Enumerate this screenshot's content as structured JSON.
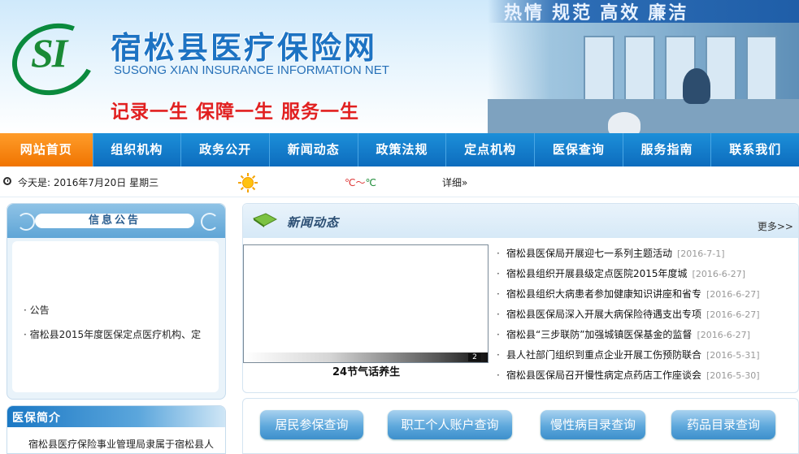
{
  "header": {
    "title": "宿松县医疗保险网",
    "subtitle": "SUSONG XIAN INSURANCE INFORMATION NET",
    "motto": "记录一生  保障一生  服务一生",
    "logo_text": "SI",
    "banner_slogan": "热情  规范  高效  廉洁",
    "colors": {
      "title": "#1d73c3",
      "motto": "#e12020",
      "logo": "#1a8a35"
    }
  },
  "nav": {
    "items": [
      "网站首页",
      "组织机构",
      "政务公开",
      "新闻动态",
      "政策法规",
      "定点机构",
      "医保查询",
      "服务指南",
      "联系我们"
    ],
    "active": "网站首页",
    "colors": {
      "bar": "#0d6cbd",
      "active": "#f07400"
    }
  },
  "datebar": {
    "date": "今天是: 2016年7月20日  星期三",
    "weather_icon": "sun-icon",
    "temp_a": "℃～",
    "temp_b": "℃",
    "detail": "详细»"
  },
  "notice": {
    "title": "信息公告",
    "items": [
      "· 公告",
      "· 宿松县2015年度医保定点医疗机构、定"
    ]
  },
  "intro": {
    "title": "医保简介",
    "text": "宿松县医疗保险事业管理局隶属于宿松县人"
  },
  "news": {
    "title": "新闻动态",
    "more": "更多>>",
    "slide_caption": "24节气话养生",
    "slide_number": "2",
    "items": [
      {
        "title": "宿松县医保局开展迎七一系列主题活动",
        "date": "[2016-7-1]"
      },
      {
        "title": "宿松县组织开展县级定点医院2015年度城",
        "date": "[2016-6-27]"
      },
      {
        "title": "宿松县组织大病患者参加健康知识讲座和省专",
        "date": "[2016-6-27]"
      },
      {
        "title": "宿松县医保局深入开展大病保险待遇支出专项",
        "date": "[2016-6-27]"
      },
      {
        "title": "宿松县“三步联防”加强城镇医保基金的监督",
        "date": "[2016-6-27]"
      },
      {
        "title": "县人社部门组织到重点企业开展工伤预防联合",
        "date": "[2016-5-31]"
      },
      {
        "title": "宿松县医保局召开慢性病定点药店工作座谈会",
        "date": "[2016-5-30]"
      }
    ]
  },
  "query": {
    "buttons": [
      "居民参保查询",
      "职工个人账户查询",
      "慢性病目录查询",
      "药品目录查询"
    ]
  }
}
